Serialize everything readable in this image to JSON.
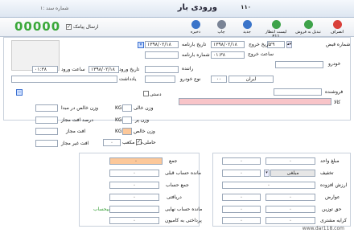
{
  "window": {
    "title": "ورودی بار",
    "counter": "۱۱۰",
    "serial_label": "شماره سند :۱"
  },
  "toolbar": [
    {
      "label": "انصراف",
      "color": "#d9403a"
    },
    {
      "label": "تبدیل به فروش",
      "color": "#3ea34a"
    },
    {
      "label": "لیست انتظار F11",
      "color": "#3ea34a"
    },
    {
      "label": "جدید",
      "color": "#3a74c9"
    },
    {
      "label": "چاپ",
      "color": "#7a8496"
    },
    {
      "label": "ذخیره",
      "color": "#3a74c9"
    }
  ],
  "counter_big": "00000",
  "pager_label": "ارسال پیامک",
  "header": {
    "receipt_no_label": "شماره قبض",
    "receipt_no": "۲۹",
    "exit_date_label": "تاریخ خروج",
    "exit_date": "۱۳۹۸/۰۲/۱۸",
    "waybill_date_label": "تاریخ بارنامه",
    "waybill_date": "۱۳۹۸/۰۲/۱۸",
    "exit_time_label": "ساعت خروج",
    "exit_time": "۰۱:۳۸",
    "waybill_no_label": "شماره بارنامه",
    "car_label": "خودرو",
    "driver_label": "راننده",
    "car_type_label": "نوع خودرو",
    "plate_label": "ایران",
    "plate_code": "۰۰",
    "entry_date_label": "تاریخ ورود",
    "entry_date": "۱۳۹۸/۰۲/۱۸",
    "entry_time_label": "ساعت ورود",
    "entry_time": "۰۱:۳۸",
    "note_label": "یادداشت",
    "seller_label": "فروشنده",
    "goods_label": "کالا",
    "manual_label": "دستی"
  },
  "weights": {
    "empty_label": "وزن خالی",
    "full_label": "وزن پر",
    "net_label": "وزن خالص",
    "unit": "KG",
    "net_min_label": "وزن خالص در مبدا",
    "loss_pct_label": "درصد افت مجاز",
    "loss_label": "افت مجاز",
    "loss_unallowed_label": "افت غیر مجاز",
    "volume_label": "متر مکعب",
    "volume": "۰",
    "load_label": "حاملی"
  },
  "totals_left": {
    "total_label": "جمع",
    "prev_balance_label": "مانده حساب قبلی",
    "sum_label": "جمع حساب",
    "received_label": "دریافتی",
    "final_balance_label": "مانده حساب نهایی",
    "final_balance_flag": "بیحساب",
    "driver_payment_label": "پرداختی به کامیون",
    "zero": "۰"
  },
  "totals_right": {
    "unit_price_label": "مبلغ واحد",
    "discount_label": "تخفیف",
    "discount_value": "مبلغی",
    "vat_label": "ارزش افزوده",
    "tolls_label": "عوارض",
    "weighing_label": "حق توزین",
    "rent_label": "کرایه مشتری",
    "zero": "۰"
  },
  "watermark": "www.dar118.com"
}
